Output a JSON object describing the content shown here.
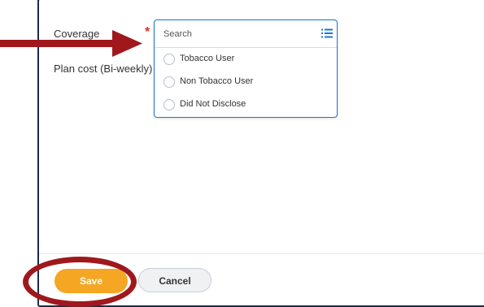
{
  "form": {
    "coverage_label": "Coverage",
    "required_marker": "*",
    "plan_cost_label": "Plan cost (Bi-weekly)"
  },
  "dropdown": {
    "search_placeholder": "Search",
    "search_value": "",
    "options": [
      {
        "label": "Tobacco User",
        "selected": false
      },
      {
        "label": "Non Tobacco User",
        "selected": false
      },
      {
        "label": "Did Not Disclose",
        "selected": false
      }
    ],
    "icon": "list-icon"
  },
  "footer": {
    "save_label": "Save",
    "cancel_label": "Cancel"
  },
  "colors": {
    "accent_blue": "#1877d6",
    "save_orange": "#f5a623",
    "annotation_red": "#a0181c",
    "required_red": "#de2e21"
  }
}
